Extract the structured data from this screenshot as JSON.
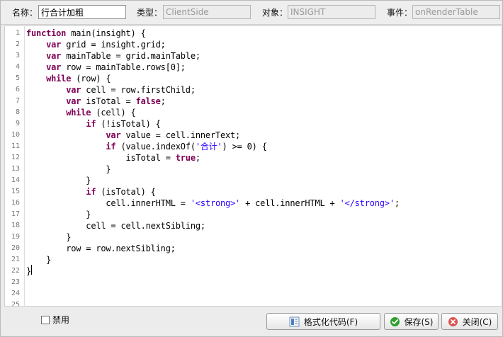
{
  "header": {
    "name_label": "名称：",
    "name_value": "行合计加粗",
    "type_label": "类型：",
    "type_value": "ClientSide",
    "object_label": "对象：",
    "object_value": "INSIGHT",
    "event_label": "事件：",
    "event_value": "onRenderTable"
  },
  "editor": {
    "line_numbers": [
      "1",
      "2",
      "3",
      "4",
      "5",
      "6",
      "7",
      "8",
      "9",
      "10",
      "11",
      "12",
      "13",
      "14",
      "15",
      "16",
      "17",
      "18",
      "19",
      "20",
      "21",
      "22",
      "23",
      "24",
      "25"
    ],
    "lines": [
      {
        "indent": 0,
        "parts": [
          {
            "t": "function",
            "c": "kw"
          },
          {
            "t": " main(insight) {"
          }
        ]
      },
      {
        "indent": 4,
        "parts": [
          {
            "t": "var",
            "c": "kw"
          },
          {
            "t": " grid = insight.grid;"
          }
        ]
      },
      {
        "indent": 4,
        "parts": [
          {
            "t": "var",
            "c": "kw"
          },
          {
            "t": " mainTable = grid.mainTable;"
          }
        ]
      },
      {
        "indent": 4,
        "parts": [
          {
            "t": "var",
            "c": "kw"
          },
          {
            "t": " row = mainTable.rows[0];"
          }
        ]
      },
      {
        "indent": 4,
        "parts": [
          {
            "t": "while",
            "c": "kw"
          },
          {
            "t": " (row) {"
          }
        ]
      },
      {
        "indent": 8,
        "parts": [
          {
            "t": "var",
            "c": "kw"
          },
          {
            "t": " cell = row.firstChild;"
          }
        ]
      },
      {
        "indent": 8,
        "parts": [
          {
            "t": "var",
            "c": "kw"
          },
          {
            "t": " isTotal = "
          },
          {
            "t": "false",
            "c": "kw"
          },
          {
            "t": ";"
          }
        ]
      },
      {
        "indent": 8,
        "parts": [
          {
            "t": "while",
            "c": "kw"
          },
          {
            "t": " (cell) {"
          }
        ]
      },
      {
        "indent": 12,
        "parts": [
          {
            "t": "if",
            "c": "kw"
          },
          {
            "t": " (!isTotal) {"
          }
        ]
      },
      {
        "indent": 16,
        "parts": [
          {
            "t": "var",
            "c": "kw"
          },
          {
            "t": " value = cell.innerText;"
          }
        ]
      },
      {
        "indent": 16,
        "parts": [
          {
            "t": "if",
            "c": "kw"
          },
          {
            "t": " (value.indexOf("
          },
          {
            "t": "'合计'",
            "c": "str"
          },
          {
            "t": ") >= 0) {"
          }
        ]
      },
      {
        "indent": 20,
        "parts": [
          {
            "t": "isTotal = "
          },
          {
            "t": "true",
            "c": "kw"
          },
          {
            "t": ";"
          }
        ]
      },
      {
        "indent": 16,
        "parts": [
          {
            "t": "}"
          }
        ]
      },
      {
        "indent": 12,
        "parts": [
          {
            "t": "}"
          }
        ]
      },
      {
        "indent": 12,
        "parts": [
          {
            "t": "if",
            "c": "kw"
          },
          {
            "t": " (isTotal) {"
          }
        ]
      },
      {
        "indent": 16,
        "parts": [
          {
            "t": "cell.innerHTML = "
          },
          {
            "t": "'<strong>'",
            "c": "str"
          },
          {
            "t": " + cell.innerHTML + "
          },
          {
            "t": "'</strong>'",
            "c": "str"
          },
          {
            "t": ";"
          }
        ]
      },
      {
        "indent": 12,
        "parts": [
          {
            "t": "}"
          }
        ]
      },
      {
        "indent": 12,
        "parts": [
          {
            "t": "cell = cell.nextSibling;"
          }
        ]
      },
      {
        "indent": 8,
        "parts": [
          {
            "t": "}"
          }
        ]
      },
      {
        "indent": 8,
        "parts": [
          {
            "t": "row = row.nextSibling;"
          }
        ]
      },
      {
        "indent": 4,
        "parts": [
          {
            "t": "}"
          }
        ]
      },
      {
        "indent": 0,
        "parts": [
          {
            "t": "}"
          }
        ]
      },
      {
        "indent": 0,
        "parts": []
      },
      {
        "indent": 0,
        "parts": []
      },
      {
        "indent": 0,
        "parts": []
      }
    ]
  },
  "footer": {
    "disable_label": "禁用",
    "format_button": "格式化代码(F)",
    "save_button": "保存(S)",
    "close_button": "关闭(C)"
  },
  "icons": {
    "format": "format-code-icon",
    "save": "check-icon",
    "close": "close-icon"
  },
  "colors": {
    "keyword": "#7f0055",
    "string": "#2a00ff",
    "save_icon": "#2f9f2f",
    "close_icon": "#d9534f"
  }
}
